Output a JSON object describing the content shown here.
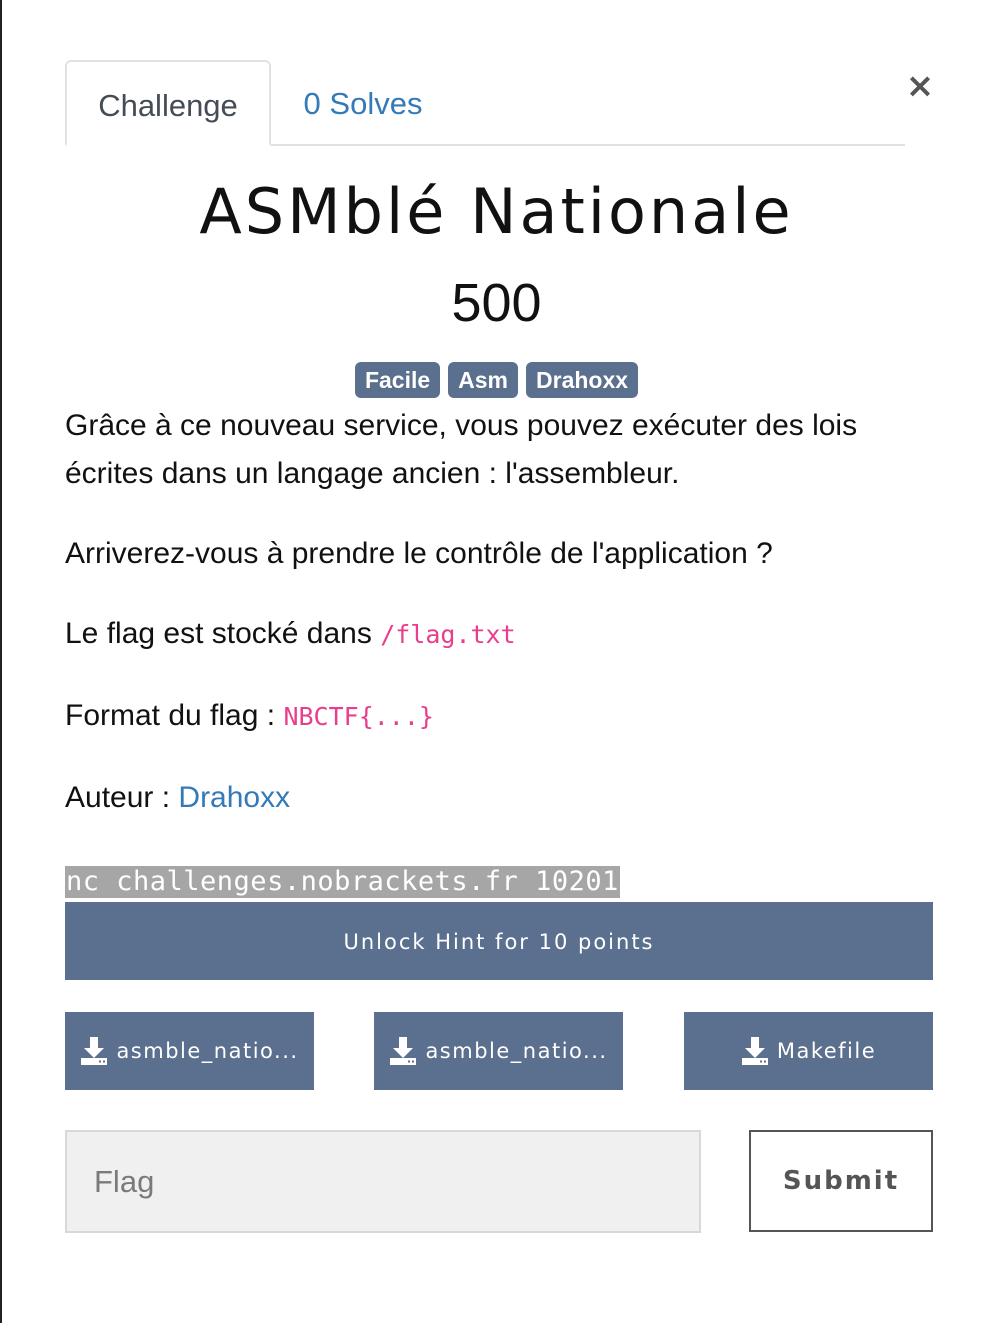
{
  "tabs": [
    {
      "label": "Challenge",
      "active": true
    },
    {
      "label": "0 Solves",
      "active": false
    }
  ],
  "close_symbol": "×",
  "challenge": {
    "name": "ASMblé Nationale",
    "points": "500",
    "tags": [
      "Facile",
      "Asm",
      "Drahoxx"
    ]
  },
  "description": {
    "p1": "Grâce à ce nouveau service, vous pouvez exécuter des lois écrites dans un langage ancien : l'assembleur.",
    "p2": "Arriverez-vous à prendre le contrôle de l'application ?",
    "p3_text": "Le flag est stocké dans ",
    "p3_code": "/flag.txt",
    "p4_text": "Format du flag : ",
    "p4_code": "NBCTF{...}",
    "p5_text": "Auteur : ",
    "p5_link": "Drahoxx"
  },
  "connection": "nc challenges.nobrackets.fr 10201",
  "hint_button": "Unlock Hint for 10 points",
  "files": [
    {
      "label": "asmble_natio...",
      "icon": "download-icon"
    },
    {
      "label": "asmble_natio...",
      "icon": "download-icon"
    },
    {
      "label": "Makefile",
      "icon": "download-icon"
    }
  ],
  "flag_form": {
    "placeholder": "Flag",
    "value": "",
    "submit_label": "Submit"
  },
  "colors": {
    "accent": "#5b6f8e",
    "link": "#337ab7",
    "code": "#e83e8c"
  }
}
